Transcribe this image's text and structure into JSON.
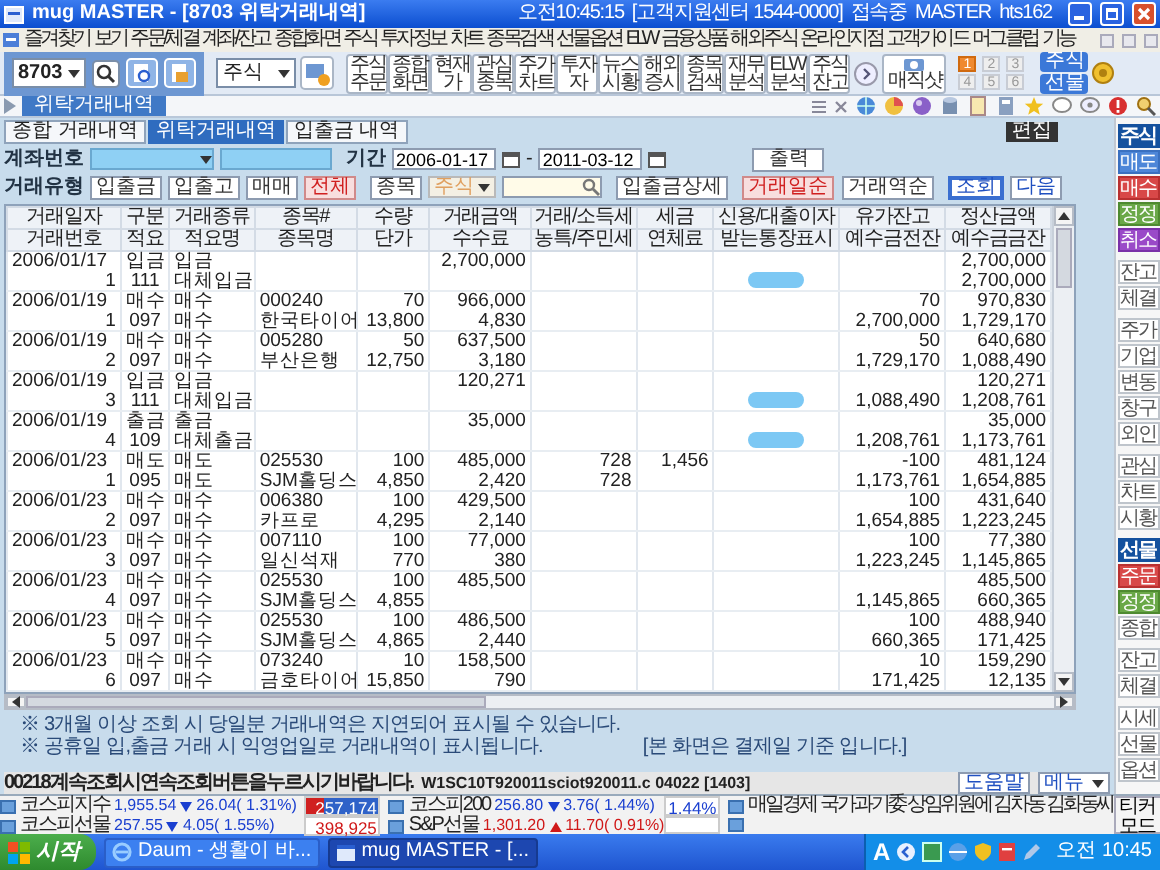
{
  "window": {
    "title": "mug MASTER - [8703 위탁거래내역]",
    "clock": "오전10:45:15",
    "support": "[고객지원센터 1544-0000]",
    "status": "접속중",
    "user": "MASTER",
    "id": "hts162"
  },
  "menu": [
    "즐겨찾기",
    "보기",
    "주문/체결",
    "계좌/잔고",
    "종합화면",
    "주식",
    "투자정보",
    "차트",
    "종목검색",
    "선물옵션",
    "ELW",
    "금융상품",
    "해외주식",
    "온라인지점",
    "고객가이드",
    "머그클럽",
    "기능"
  ],
  "toolbar": {
    "screen_code": "8703",
    "market": "주식",
    "buttons": [
      "주식 주문",
      "종합 화면",
      "현재 가",
      "관심 종목",
      "주가 차트",
      "투자 자",
      "뉴스 시황",
      "해외 증시",
      "종목 검색",
      "재무 분석",
      "ELW 분석",
      "주식 잔고"
    ],
    "magic_shot": "매직샷",
    "slots": [
      {
        "label": "1",
        "selected": true
      },
      {
        "label": "2",
        "selected": false
      },
      {
        "label": "3",
        "selected": false
      },
      {
        "label": "4",
        "selected": false
      },
      {
        "label": "5",
        "selected": false
      },
      {
        "label": "6",
        "selected": false
      }
    ],
    "quick": [
      "주식",
      "선물"
    ]
  },
  "window_tab": "위탁거래내역",
  "tabs": [
    {
      "label": "종합 거래내역",
      "selected": false
    },
    {
      "label": "위탁거래내역",
      "selected": true
    },
    {
      "label": "입출금 내역",
      "selected": false
    }
  ],
  "edit_button": "편집",
  "filters": {
    "account_label": "계좌번호",
    "period_label": "기간",
    "date_from": "2006-01-17",
    "range_separator": "-",
    "date_to": "2011-03-12",
    "print": "출력",
    "type_label": "거래유형",
    "types": [
      {
        "label": "입출금",
        "selected": false
      },
      {
        "label": "입출고",
        "selected": false
      },
      {
        "label": "매매",
        "selected": false
      },
      {
        "label": "전체",
        "selected": true
      }
    ],
    "item_button": "종목",
    "item_market": "주식",
    "detail": "입출금상세",
    "orders": [
      {
        "label": "거래일순",
        "selected": true
      },
      {
        "label": "거래역순",
        "selected": false
      }
    ],
    "query": "조회",
    "next": "다음"
  },
  "table": {
    "columns": [
      {
        "top": "거래일자",
        "bottom": "거래번호"
      },
      {
        "top": "구분",
        "bottom": "적요"
      },
      {
        "top": "거래종류",
        "bottom": "적요명"
      },
      {
        "top": "종목#",
        "bottom": "종목명"
      },
      {
        "top": "수량",
        "bottom": "단가"
      },
      {
        "top": "거래금액",
        "bottom": "수수료"
      },
      {
        "top": "거래/소득세",
        "bottom": "농특/주민세"
      },
      {
        "top": "세금",
        "bottom": "연체료"
      },
      {
        "top": "신용/대출이자",
        "bottom": "받는통장표시"
      },
      {
        "top": "유가잔고",
        "bottom": "예수금전잔"
      },
      {
        "top": "정산금액",
        "bottom": "예수금금잔"
      }
    ],
    "records": [
      {
        "line_1": {
          "date": "2006/01/17",
          "category": "입금",
          "trade_type": "입금",
          "amount": "2,700,000",
          "settlement": "2,700,000"
        },
        "line_2": {
          "number": "1",
          "memo": "111",
          "memo_name": "대체입금",
          "deposit_after": "2,700,000"
        },
        "masked_account": true
      },
      {
        "line_1": {
          "date": "2006/01/19",
          "category": "매수",
          "trade_type": "매수",
          "code": "000240",
          "quantity": "70",
          "amount": "966,000",
          "stock_balance": "70",
          "settlement": "970,830"
        },
        "line_2": {
          "number": "1",
          "memo": "097",
          "memo_name": "매수",
          "name": "한국타이어",
          "unit_price": "13,800",
          "fee": "4,830",
          "deposit_before": "2,700,000",
          "deposit_after": "1,729,170"
        },
        "masked_account": false
      },
      {
        "line_1": {
          "date": "2006/01/19",
          "category": "매수",
          "trade_type": "매수",
          "code": "005280",
          "quantity": "50",
          "amount": "637,500",
          "stock_balance": "50",
          "settlement": "640,680"
        },
        "line_2": {
          "number": "2",
          "memo": "097",
          "memo_name": "매수",
          "name": "부산은행",
          "unit_price": "12,750",
          "fee": "3,180",
          "deposit_before": "1,729,170",
          "deposit_after": "1,088,490"
        },
        "masked_account": false
      },
      {
        "line_1": {
          "date": "2006/01/19",
          "category": "입금",
          "trade_type": "입금",
          "amount": "120,271",
          "settlement": "120,271"
        },
        "line_2": {
          "number": "3",
          "memo": "111",
          "memo_name": "대체입금",
          "deposit_before": "1,088,490",
          "deposit_after": "1,208,761"
        },
        "masked_account": true
      },
      {
        "line_1": {
          "date": "2006/01/19",
          "category": "출금",
          "trade_type": "출금",
          "amount": "35,000",
          "settlement": "35,000"
        },
        "line_2": {
          "number": "4",
          "memo": "109",
          "memo_name": "대체출금",
          "deposit_before": "1,208,761",
          "deposit_after": "1,173,761"
        },
        "masked_account": true
      },
      {
        "line_1": {
          "date": "2006/01/23",
          "category": "매도",
          "trade_type": "매도",
          "code": "025530",
          "quantity": "100",
          "amount": "485,000",
          "trade_tax": "728",
          "tax": "1,456",
          "stock_balance": "-100",
          "settlement": "481,124"
        },
        "line_2": {
          "number": "1",
          "memo": "095",
          "memo_name": "매도",
          "name": "SJM홀딩스",
          "unit_price": "4,850",
          "fee": "2,420",
          "special_tax": "728",
          "deposit_before": "1,173,761",
          "deposit_after": "1,654,885"
        },
        "masked_account": false
      },
      {
        "line_1": {
          "date": "2006/01/23",
          "category": "매수",
          "trade_type": "매수",
          "code": "006380",
          "quantity": "100",
          "amount": "429,500",
          "stock_balance": "100",
          "settlement": "431,640"
        },
        "line_2": {
          "number": "2",
          "memo": "097",
          "memo_name": "매수",
          "name": "카프로",
          "unit_price": "4,295",
          "fee": "2,140",
          "deposit_before": "1,654,885",
          "deposit_after": "1,223,245"
        },
        "masked_account": false
      },
      {
        "line_1": {
          "date": "2006/01/23",
          "category": "매수",
          "trade_type": "매수",
          "code": "007110",
          "quantity": "100",
          "amount": "77,000",
          "stock_balance": "100",
          "settlement": "77,380"
        },
        "line_2": {
          "number": "3",
          "memo": "097",
          "memo_name": "매수",
          "name": "일신석재",
          "unit_price": "770",
          "fee": "380",
          "deposit_before": "1,223,245",
          "deposit_after": "1,145,865"
        },
        "masked_account": false
      },
      {
        "line_1": {
          "date": "2006/01/23",
          "category": "매수",
          "trade_type": "매수",
          "code": "025530",
          "quantity": "100",
          "amount": "485,500",
          "settlement": "485,500"
        },
        "line_2": {
          "number": "4",
          "memo": "097",
          "memo_name": "매수",
          "name": "SJM홀딩스",
          "unit_price": "4,855",
          "deposit_before": "1,145,865",
          "deposit_after": "660,365"
        },
        "masked_account": false
      },
      {
        "line_1": {
          "date": "2006/01/23",
          "category": "매수",
          "trade_type": "매수",
          "code": "025530",
          "quantity": "100",
          "amount": "486,500",
          "stock_balance": "100",
          "settlement": "488,940"
        },
        "line_2": {
          "number": "5",
          "memo": "097",
          "memo_name": "매수",
          "name": "SJM홀딩스",
          "unit_price": "4,865",
          "fee": "2,440",
          "deposit_before": "660,365",
          "deposit_after": "171,425"
        },
        "masked_account": false
      },
      {
        "line_1": {
          "date": "2006/01/23",
          "category": "매수",
          "trade_type": "매수",
          "code": "073240",
          "quantity": "10",
          "amount": "158,500",
          "stock_balance": "10",
          "settlement": "159,290"
        },
        "line_2": {
          "number": "6",
          "memo": "097",
          "memo_name": "매수",
          "name": "금호타이어",
          "unit_price": "15,850",
          "fee": "790",
          "deposit_before": "171,425",
          "deposit_after": "12,135"
        },
        "masked_account": false
      }
    ]
  },
  "notes": [
    "※ 3개월 이상 조회 시 당일분 거래내역은 지연되어 표시될 수 있습니다.",
    "※ 공휴일 입,출금 거래 시 익영업일로 거래내역이 표시됩니다."
  ],
  "basis_note": "[본 화면은 결제일 기준 입니다.]",
  "status_bar": {
    "message": "00218계속조회시연속조회버튼을누르시기바랍니다.",
    "module": "W1SC10T920011sciot920011.c",
    "code": "04022",
    "number": "[1403]",
    "help": "도움말",
    "menu": "메뉴"
  },
  "sidebar": {
    "groups": [
      {
        "items": [
          {
            "label": "주식",
            "kind": "header"
          },
          {
            "label": "매도",
            "kind": "sell"
          },
          {
            "label": "매수",
            "kind": "buy"
          },
          {
            "label": "정정",
            "kind": "modify"
          },
          {
            "label": "취소",
            "kind": "cancel"
          }
        ]
      },
      {
        "items": [
          {
            "label": "잔고",
            "kind": "plain"
          },
          {
            "label": "체결",
            "kind": "plain"
          }
        ]
      },
      {
        "items": [
          {
            "label": "주가",
            "kind": "plain"
          },
          {
            "label": "기업",
            "kind": "plain"
          },
          {
            "label": "변동",
            "kind": "plain"
          },
          {
            "label": "창구",
            "kind": "plain"
          },
          {
            "label": "외인",
            "kind": "plain"
          }
        ]
      },
      {
        "items": [
          {
            "label": "관심",
            "kind": "plain"
          },
          {
            "label": "차트",
            "kind": "plain"
          },
          {
            "label": "시황",
            "kind": "plain"
          }
        ]
      },
      {
        "items": [
          {
            "label": "선물",
            "kind": "header"
          },
          {
            "label": "주문",
            "kind": "buy"
          },
          {
            "label": "정정",
            "kind": "modify"
          },
          {
            "label": "종합",
            "kind": "plain"
          }
        ]
      },
      {
        "items": [
          {
            "label": "잔고",
            "kind": "plain"
          },
          {
            "label": "체결",
            "kind": "plain"
          }
        ]
      },
      {
        "items": [
          {
            "label": "시세",
            "kind": "plain"
          },
          {
            "label": "선물",
            "kind": "plain"
          },
          {
            "label": "옵션",
            "kind": "plain"
          }
        ]
      }
    ]
  },
  "tickers": [
    {
      "name": "코스피지수",
      "value": "1,955.54",
      "up": false,
      "change": "26.04( 1.31%)",
      "volume": {
        "text": "257,174",
        "level": 0.25
      }
    },
    {
      "name": "코스피200",
      "value": "256.80",
      "up": false,
      "change": "3.76( 1.44%)",
      "rate": "1.44%"
    },
    {
      "name": "코스피선물",
      "value": "257.55",
      "up": false,
      "change": "4.05( 1.55%)",
      "volume": {
        "text": "398,925"
      }
    },
    {
      "name": "S&P선물",
      "value": "1,301.20",
      "up": true,
      "change": "11.70( 0.91%)"
    }
  ],
  "news": {
    "source": "매일경제",
    "headline": "국가과기委 상임위원에 김차동 김화동씨"
  },
  "ticker_mode": "티커 모드",
  "taskbar": {
    "start": "시작",
    "tasks": [
      {
        "label": "Daum - 생활이 바...",
        "kind": "browser",
        "selected": false
      },
      {
        "label": "mug MASTER - [...",
        "kind": "app",
        "selected": true
      }
    ],
    "ime": "A",
    "clock": "오전 10:45"
  }
}
